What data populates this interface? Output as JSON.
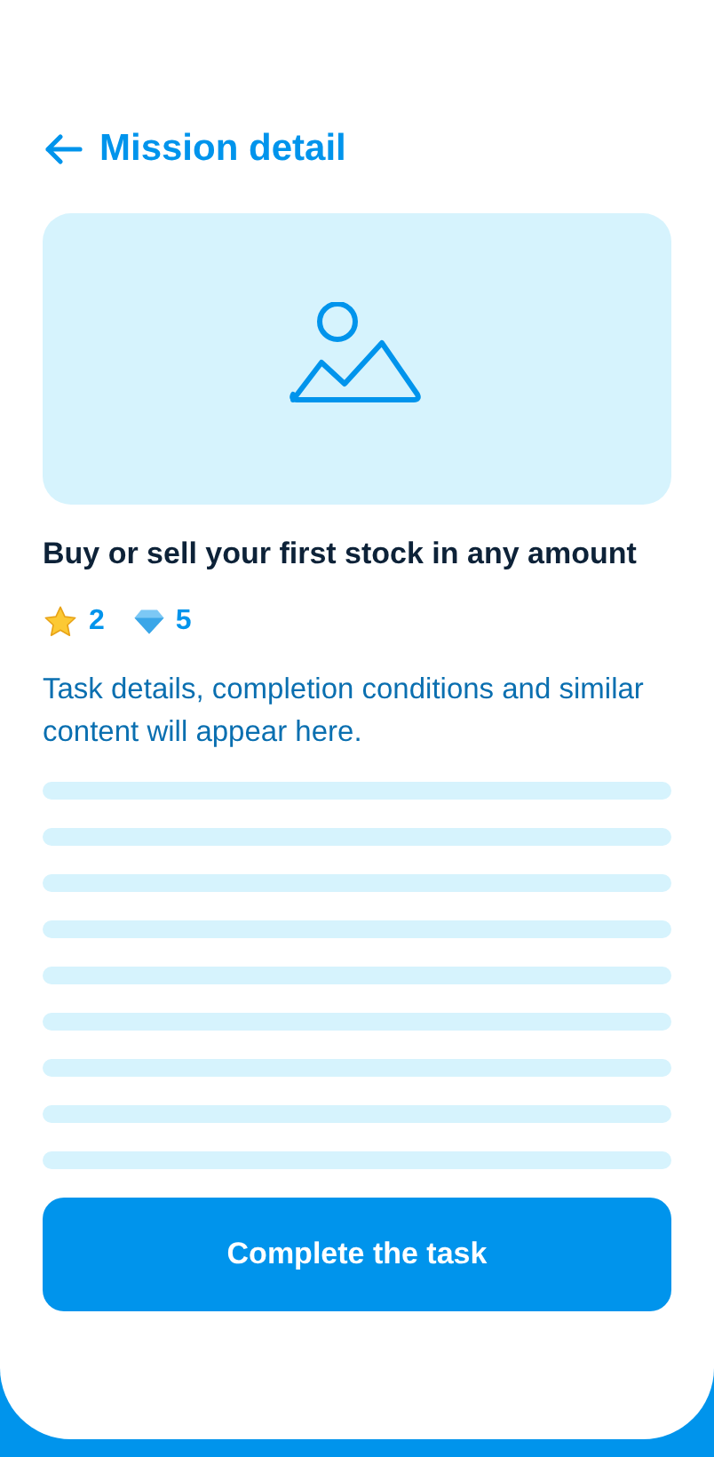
{
  "header": {
    "title": "Mission detail"
  },
  "mission": {
    "title": "Buy or sell your first stock in any amount",
    "rewards": [
      {
        "kind": "star",
        "amount": "2"
      },
      {
        "kind": "gem",
        "amount": "5"
      }
    ],
    "description": "Task details, completion conditions and similar content will appear here."
  },
  "button": {
    "label": "Complete the task"
  }
}
